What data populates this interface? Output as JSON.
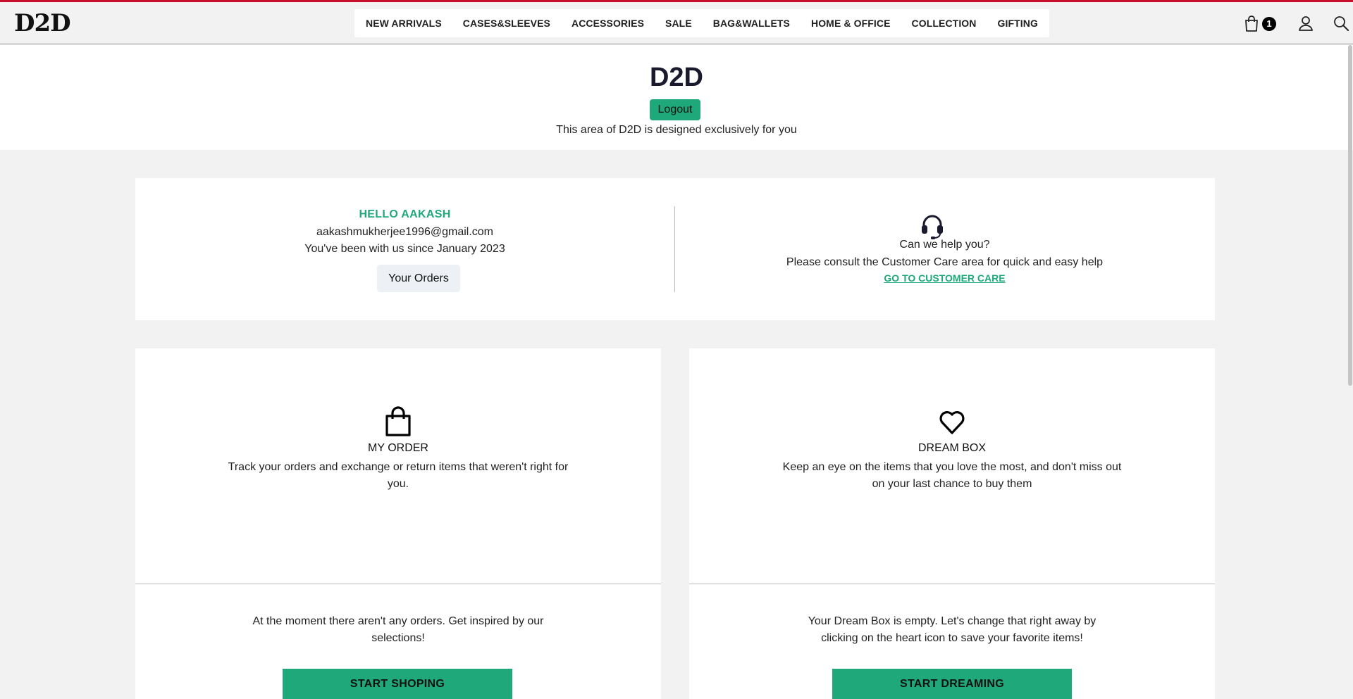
{
  "brand": {
    "logo_text": "D2D",
    "accent": "#1fa87a",
    "topline": "#c8102e"
  },
  "nav": {
    "items": [
      {
        "label": "NEW ARRIVALS"
      },
      {
        "label": "CASES&SLEEVES"
      },
      {
        "label": "ACCESSORIES"
      },
      {
        "label": "SALE"
      },
      {
        "label": "BAG&WALLETS"
      },
      {
        "label": "HOME & OFFICE"
      },
      {
        "label": "COLLECTION"
      },
      {
        "label": "GIFTING"
      }
    ]
  },
  "header_icons": {
    "cart_icon": "shopping-bag-icon",
    "cart_count": "1",
    "user_icon": "user-icon",
    "search_icon": "search-icon"
  },
  "hero": {
    "title": "D2D",
    "logout_label": "Logout",
    "subtitle": "This area of D2D is designed exclusively for you"
  },
  "account": {
    "greeting": "HELLO AAKASH",
    "email": "aakashmukherjee1996@gmail.com",
    "member_since": "You've been with us since January 2023",
    "orders_button": "Your Orders"
  },
  "help": {
    "icon": "headset-icon",
    "title": "Can we help you?",
    "text": "Please consult the Customer Care area for quick and easy help",
    "link_label": "GO TO CUSTOMER CARE"
  },
  "my_order": {
    "icon": "shopping-bag-icon",
    "title": "MY ORDER",
    "description": "Track your orders and exchange or return items that weren't right for you.",
    "empty_text": "At the moment there aren't any orders. Get inspired by our selections!",
    "cta_label": "START SHOPING"
  },
  "dream_box": {
    "icon": "heart-icon",
    "title": "DREAM BOX",
    "description": "Keep an eye on the items that you love the most, and don't miss out on your last chance to buy them",
    "empty_text": "Your Dream Box is empty. Let's change that right away by clicking on the heart icon to save your favorite items!",
    "cta_label": "START DREAMING"
  }
}
